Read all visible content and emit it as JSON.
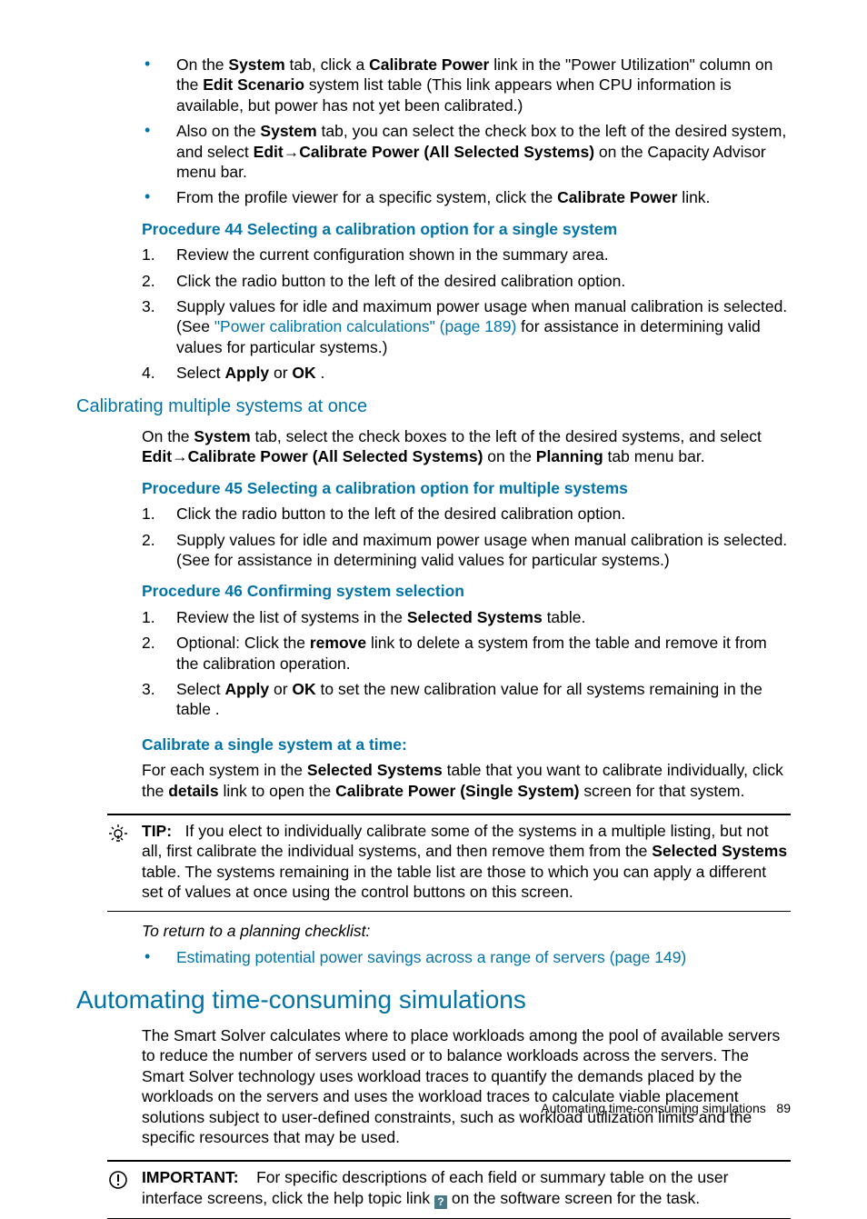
{
  "list_intro": [
    {
      "pre": "On the ",
      "b1": "System",
      "mid1": " tab, click a ",
      "b2": "Calibrate Power",
      "mid2": " link in the \"Power Utilization\" column on the ",
      "b3": "Edit Scenario",
      "post": " system list table (This link appears when CPU information is available, but power has not yet been calibrated.)"
    },
    {
      "pre": "Also on the ",
      "b1": "System",
      "mid1": " tab, you can select the check box to the left of the desired system, and select ",
      "b2": "Edit",
      "arrow": "→",
      "b3": "Calibrate Power (All Selected Systems)",
      "post": " on the Capacity Advisor menu bar."
    },
    {
      "pre": "From the profile viewer for a specific system, click the ",
      "b1": "Calibrate Power",
      "post": " link."
    }
  ],
  "proc44": {
    "title": "Procedure 44 Selecting a calibration option for a single system",
    "steps": [
      {
        "text": "Review the current configuration shown in the summary area."
      },
      {
        "text": "Click the radio button to the left of the desired calibration option."
      },
      {
        "pre": "Supply values for idle and maximum power usage when manual calibration is selected. (See ",
        "link": "\"Power calibration calculations\" (page 189)",
        "post": " for assistance in determining valid values for particular systems.)"
      },
      {
        "pre": "Select ",
        "b1": "Apply",
        "mid": " or ",
        "b2": "OK",
        "post": " ."
      }
    ]
  },
  "h3": "Calibrating multiple systems at once",
  "multi_intro": {
    "pre": "On the ",
    "b1": "System",
    "mid1": " tab, select the check boxes to the left of the desired systems, and select ",
    "b2": "Edit",
    "arrow": "→",
    "b3": "Calibrate Power (All Selected Systems)",
    "mid2": " on the ",
    "b4": "Planning",
    "post": " tab menu bar."
  },
  "proc45": {
    "title": "Procedure 45 Selecting a calibration option for multiple systems",
    "steps": [
      {
        "text": "Click the radio button to the left of the desired calibration option."
      },
      {
        "text": "Supply values for idle and maximum power usage when manual calibration is selected. (See for assistance in determining valid values for particular systems.)"
      }
    ]
  },
  "proc46": {
    "title": "Procedure 46 Confirming system selection",
    "steps": [
      {
        "pre": "Review the list of systems in the ",
        "b1": "Selected Systems",
        "post": " table."
      },
      {
        "pre": "Optional: Click the ",
        "b1": "remove",
        "post": " link to delete a system from the table and remove it from the calibration operation."
      },
      {
        "pre": "Select ",
        "b1": "Apply",
        "mid": " or ",
        "b2": "OK",
        "post": " to set the new calibration value for all systems remaining in the table ."
      }
    ]
  },
  "calib_single": {
    "title": "Calibrate a single system at a time:",
    "pre": "For each system in the ",
    "b1": "Selected Systems",
    "mid1": " table that you want to calibrate individually, click the ",
    "b2": "details",
    "mid2": " link to open the ",
    "b3": "Calibrate Power (Single System)",
    "post": " screen for that system."
  },
  "tip": {
    "label": "TIP:",
    "pre": "If you elect to individually calibrate some of the systems in a multiple listing, but not all, first calibrate the individual systems, and then remove them from the ",
    "b1": "Selected Systems",
    "post": " table. The systems remaining in the table list are those to which you can apply a different set of values at once using the control buttons on this screen."
  },
  "return": {
    "label": "To return to a planning checklist:",
    "link": "Estimating potential power savings across a range of servers (page 149)"
  },
  "h2": "Automating time-consuming simulations",
  "h2_body": "The Smart Solver calculates where to place workloads among the pool of available servers to reduce the number of servers used or to balance workloads across the servers. The Smart Solver technology uses workload traces to quantify the demands placed by the workloads on the servers and uses the workload traces to calculate viable placement solutions subject to user-defined constraints, such as workload utilization limits and the specific resources that may be used.",
  "important": {
    "label": "IMPORTANT:",
    "pre": "For specific descriptions of each field or summary table on the user interface screens, click the help topic link ",
    "icon": "?",
    "post": " on the software screen for the task."
  },
  "footer": {
    "text": "Automating time-consuming simulations",
    "page": "89"
  }
}
